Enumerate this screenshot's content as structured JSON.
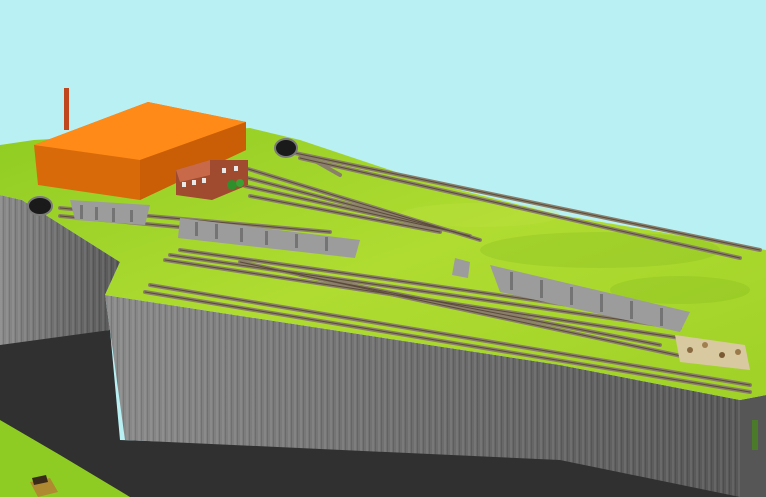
{
  "scene": {
    "description_visible_text": "",
    "colors": {
      "sky": "#b8f0f4",
      "terrain": "#9cd22a",
      "terrain_dark": "#7db51f",
      "cliff": "#7a7a7a",
      "cliff_dark": "#4e4e4e",
      "ground_lower": "#2e2e2e",
      "grass_lower": "#8fcc23",
      "factory_roof": "#ff8a17",
      "factory_side": "#d96a0a",
      "chimney": "#c0461e",
      "station_brick": "#a04a30",
      "track_ballast": "#8a7f6a",
      "track_rail": "#5b4a3a",
      "rocks": "#9c9c9c"
    },
    "icons": [
      "tunnel-portal-icon",
      "factory-building-icon",
      "station-building-icon",
      "locomotive-icon"
    ]
  }
}
